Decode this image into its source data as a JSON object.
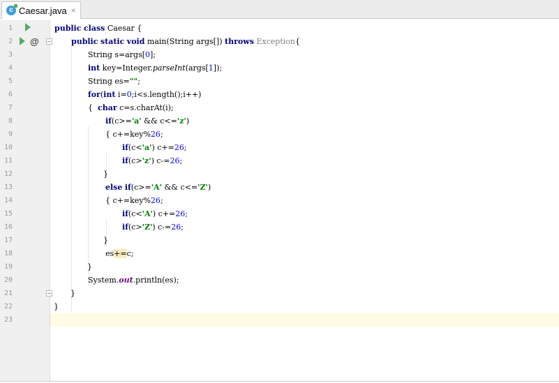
{
  "tab": {
    "label": "Caesar.java",
    "close": "×",
    "icon_letter": "c"
  },
  "icons": {
    "run": "run-icon",
    "at": "@",
    "fold": "fold-icon"
  },
  "lines": [
    {
      "n": "1"
    },
    {
      "n": "2"
    },
    {
      "n": "3"
    },
    {
      "n": "4"
    },
    {
      "n": "5"
    },
    {
      "n": "6"
    },
    {
      "n": "7"
    },
    {
      "n": "8"
    },
    {
      "n": "9"
    },
    {
      "n": "10"
    },
    {
      "n": "11"
    },
    {
      "n": "12"
    },
    {
      "n": "13"
    },
    {
      "n": "14"
    },
    {
      "n": "15"
    },
    {
      "n": "16"
    },
    {
      "n": "17"
    },
    {
      "n": "18"
    },
    {
      "n": "19"
    },
    {
      "n": "20"
    },
    {
      "n": "21"
    },
    {
      "n": "22"
    },
    {
      "n": "23"
    }
  ],
  "code": {
    "l1": [
      "public",
      " ",
      "class",
      " Caesar {"
    ],
    "l2": [
      "public",
      " ",
      "static",
      " ",
      "void",
      " main(String args[]) ",
      "throws",
      " ",
      "Exception",
      "{"
    ],
    "l3": [
      "String s=args[",
      "0",
      "];"
    ],
    "l4": [
      "int",
      " key=Integer.",
      "parseInt",
      "(args[",
      "1",
      "]);"
    ],
    "l5": [
      "String es=",
      "\"\"",
      ";"
    ],
    "l6": [
      "for",
      "(",
      "int",
      " i=",
      "0",
      ";i<s.length();i++)"
    ],
    "l7": [
      "{  ",
      "char",
      " c=s.charAt(i);"
    ],
    "l8": [
      "if",
      "(c>=",
      "'a'",
      " && c<=",
      "'z'",
      ")"
    ],
    "l9": [
      "{ c+=key%",
      "26",
      ";"
    ],
    "l10": [
      "if",
      "(c<",
      "'a'",
      ") c+=",
      "26",
      ";"
    ],
    "l11": [
      "if",
      "(c>",
      "'z'",
      ") c-=",
      "26",
      ";"
    ],
    "l12": [
      "}"
    ],
    "l13": [
      "else",
      " ",
      "if",
      "(c>=",
      "'A'",
      " && c<=",
      "'Z'",
      ")"
    ],
    "l14": [
      "{ c+=key%",
      "26",
      ";"
    ],
    "l15": [
      "if",
      "(c<",
      "'A'",
      ") c+=",
      "26",
      ";"
    ],
    "l16": [
      "if",
      "(c>",
      "'Z'",
      ") c-=",
      "26",
      ";"
    ],
    "l17": [
      "}"
    ],
    "l18": [
      "es",
      "+=",
      "c;"
    ],
    "l19": [
      "}"
    ],
    "l20": [
      "System.",
      "out",
      ".println(es);"
    ],
    "l21": [
      "}"
    ],
    "l22": [
      "}"
    ]
  },
  "colors": {
    "keyword": "#000080",
    "number": "#0000ff",
    "string": "#008000",
    "field": "#660e7a",
    "run": "#59a869",
    "current_line": "#fffae3"
  }
}
